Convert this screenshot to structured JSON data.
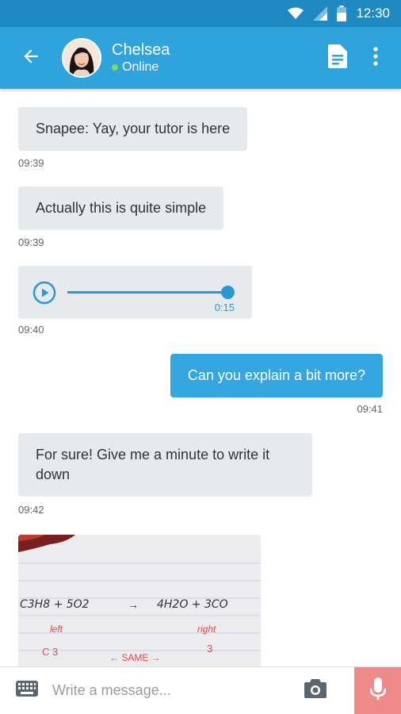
{
  "status_bar": {
    "time": "12:30",
    "icons": [
      "wifi-icon",
      "signal-icon",
      "battery-icon"
    ]
  },
  "header": {
    "back_icon": "arrow-left-icon",
    "contact_name": "Chelsea",
    "contact_status": "Online",
    "actions": [
      "document-icon",
      "more-vert-icon"
    ]
  },
  "messages": [
    {
      "direction": "incoming",
      "type": "text",
      "text": "Snapee: Yay, your tutor is here",
      "time": "09:39"
    },
    {
      "direction": "incoming",
      "type": "text",
      "text": "Actually this is quite simple",
      "time": "09:39"
    },
    {
      "direction": "incoming",
      "type": "audio",
      "duration": "0:15",
      "progress": 1.0,
      "time": "09:40"
    },
    {
      "direction": "outgoing",
      "type": "text",
      "text": "Can you explain a bit more?",
      "time": "09:41"
    },
    {
      "direction": "incoming",
      "type": "text",
      "text": "For sure! Give me a minute to write it down",
      "time": "09:42"
    },
    {
      "direction": "incoming",
      "type": "image",
      "image_text": {
        "equation_left": "C3H8 + 5O2",
        "arrow": "→",
        "equation_right": "4H2O + 3CO",
        "left_label": "left",
        "right_label": "right",
        "left_value": "C 3",
        "same_label": "← SAME →",
        "right_value": "3"
      }
    }
  ],
  "composer": {
    "placeholder": "Write a message...",
    "keyboard_icon": "keyboard-icon",
    "camera_icon": "camera-icon",
    "mic_icon": "microphone-icon"
  },
  "colors": {
    "status_bar": "#1f89c2",
    "app_bar": "#2ea3dc",
    "incoming_bubble": "#e7eaed",
    "outgoing_bubble": "#35a6df",
    "mic_button": "#ee8a8a",
    "online_dot": "#7ed957"
  }
}
